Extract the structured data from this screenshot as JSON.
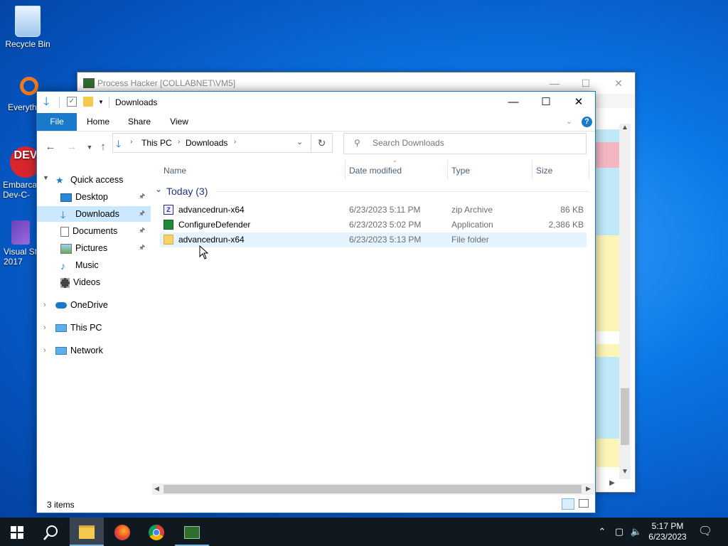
{
  "desktop": {
    "icons": [
      {
        "label": "Recycle Bin"
      },
      {
        "label": "Everyth"
      },
      {
        "label": "Embarca Dev-C-"
      },
      {
        "label": "Visual St 2017"
      }
    ]
  },
  "background_window": {
    "title": "Process Hacker [COLLABNET\\VM5]"
  },
  "explorer": {
    "title": "Downloads",
    "ribbon_tabs": [
      "File",
      "Home",
      "Share",
      "View"
    ],
    "breadcrumb": [
      "This PC",
      "Downloads"
    ],
    "search_placeholder": "Search Downloads",
    "sidebar": {
      "quick_access": "Quick access",
      "items": [
        {
          "label": "Desktop",
          "pinned": true,
          "icon": "desktop-icon"
        },
        {
          "label": "Downloads",
          "pinned": true,
          "icon": "download-icon"
        },
        {
          "label": "Documents",
          "pinned": true,
          "icon": "document-icon"
        },
        {
          "label": "Pictures",
          "pinned": true,
          "icon": "pictures-icon"
        },
        {
          "label": "Music",
          "pinned": false,
          "icon": "music-icon"
        },
        {
          "label": "Videos",
          "pinned": false,
          "icon": "video-icon"
        }
      ],
      "roots": [
        {
          "label": "OneDrive",
          "icon": "cloud-icon"
        },
        {
          "label": "This PC",
          "icon": "computer-icon"
        },
        {
          "label": "Network",
          "icon": "network-icon"
        }
      ]
    },
    "columns": {
      "name": "Name",
      "date": "Date modified",
      "type": "Type",
      "size": "Size"
    },
    "group_header": "Today (3)",
    "files": [
      {
        "name": "advancedrun-x64",
        "date": "6/23/2023 5:11 PM",
        "type": "zip Archive",
        "size": "86 KB",
        "icon": "zip-icon"
      },
      {
        "name": "ConfigureDefender",
        "date": "6/23/2023 5:02 PM",
        "type": "Application",
        "size": "2,386 KB",
        "icon": "app-icon"
      },
      {
        "name": "advancedrun-x64",
        "date": "6/23/2023 5:13 PM",
        "type": "File folder",
        "size": "",
        "icon": "folder-icon"
      }
    ],
    "status": "3 items"
  },
  "taskbar": {
    "time": "5:17 PM",
    "date": "6/23/2023"
  },
  "colors": {
    "accent": "#1979ca",
    "selection": "#cce8ff",
    "hover": "#e5f3ff",
    "taskbar": "#101820"
  }
}
